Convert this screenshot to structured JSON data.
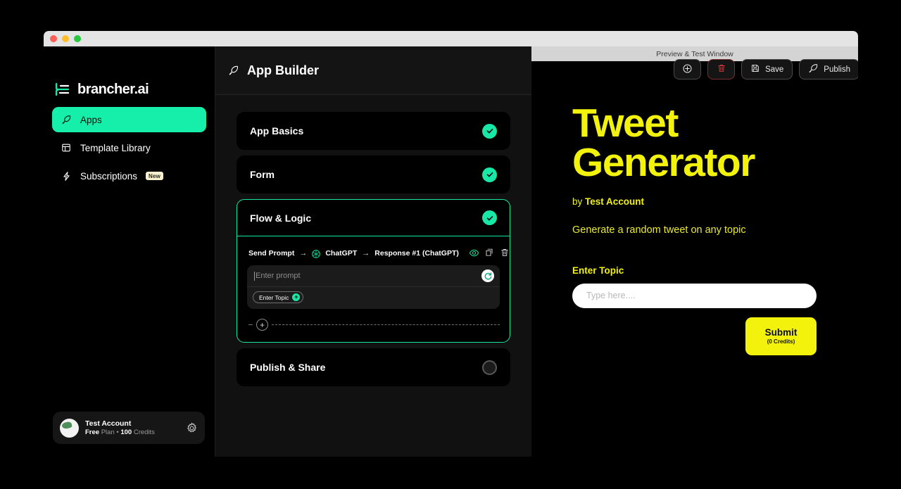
{
  "window": {
    "traffic_lights": [
      "red",
      "yellow",
      "green"
    ]
  },
  "sidebar": {
    "logo": {
      "text": "brancher.ai",
      "icon": "brancher-logo-icon"
    },
    "items": [
      {
        "label": "Apps",
        "icon": "rocket-icon",
        "active": true,
        "badge": ""
      },
      {
        "label": "Template Library",
        "icon": "layout-icon",
        "active": false,
        "badge": ""
      },
      {
        "label": "Subscriptions",
        "icon": "bolt-icon",
        "active": false,
        "badge": "New"
      }
    ],
    "account": {
      "name": "Test Account",
      "plan_prefix": "Free",
      "plan_word": "Plan",
      "separator": "•",
      "credits_value": "100",
      "credits_word": "Credits",
      "settings_icon": "gear-icon"
    }
  },
  "topbar": {
    "title": "App Builder",
    "title_icon": "rocket-icon",
    "buttons": [
      {
        "name": "add",
        "label": "",
        "icon": "plus-circle-icon"
      },
      {
        "name": "delete",
        "label": "",
        "icon": "trash-icon"
      },
      {
        "name": "save",
        "label": "Save",
        "icon": "floppy-disk-icon"
      },
      {
        "name": "publish",
        "label": "Publish",
        "icon": "rocket-icon"
      }
    ]
  },
  "builder": {
    "sections": [
      {
        "title": "App Basics",
        "status": "complete",
        "open": false
      },
      {
        "title": "Form",
        "status": "complete",
        "open": false
      },
      {
        "title": "Flow & Logic",
        "status": "complete",
        "open": true
      },
      {
        "title": "Publish & Share",
        "status": "incomplete",
        "open": false
      }
    ],
    "flow": {
      "step_label": "Send Prompt",
      "arrow": "→",
      "model": "ChatGPT",
      "model_icon": "openai-icon",
      "output_label": "Response #1 (ChatGPT)",
      "actions": [
        {
          "name": "preview",
          "icon": "eye-icon"
        },
        {
          "name": "duplicate",
          "icon": "copy-icon"
        },
        {
          "name": "delete",
          "icon": "trash-icon"
        }
      ],
      "prompt_placeholder": "Enter prompt",
      "refresh_icon": "refresh-icon",
      "variable_chips": [
        {
          "label": "Enter Topic",
          "action": "add"
        }
      ],
      "add_step_icon": "plus-circle-icon"
    }
  },
  "preview": {
    "bar_label": "Preview & Test Window",
    "app_title": "Tweet Generator",
    "by_prefix": "by",
    "author": "Test Account",
    "description": "Generate a random tweet on any topic",
    "field_label": "Enter Topic",
    "field_placeholder": "Type here....",
    "field_value": "",
    "submit_label": "Submit",
    "submit_sub": "(0 Credits)"
  },
  "colors": {
    "accent_green": "#17e8a6",
    "accent_yellow": "#f2f20d",
    "sidebar_bg": "#000000",
    "center_bg": "#111111",
    "danger_red": "#7a2f2f"
  }
}
